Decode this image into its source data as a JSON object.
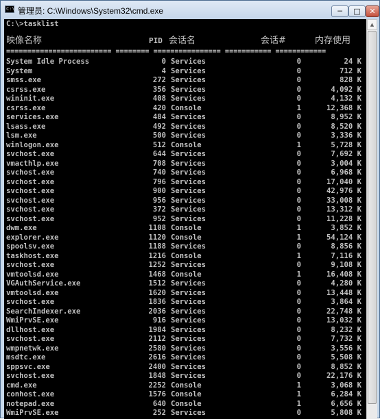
{
  "window": {
    "title": "管理员: C:\\Windows\\System32\\cmd.exe",
    "icon_label": "C:\\",
    "minimize_glyph": "─",
    "maximize_glyph": "□",
    "close_glyph": "✕"
  },
  "console": {
    "prompt_line": "C:\\>tasklist",
    "headers": {
      "image_name": "映像名称",
      "pid": "PID",
      "session_name": "会话名",
      "session_num": "会话#",
      "mem_usage": "内存使用"
    },
    "separator": "========================= ======== ================ =========== ============",
    "processes": [
      {
        "name": "System Idle Process",
        "pid": "0",
        "session": "Services",
        "num": "0",
        "mem": "24 K"
      },
      {
        "name": "System",
        "pid": "4",
        "session": "Services",
        "num": "0",
        "mem": "712 K"
      },
      {
        "name": "smss.exe",
        "pid": "272",
        "session": "Services",
        "num": "0",
        "mem": "828 K"
      },
      {
        "name": "csrss.exe",
        "pid": "356",
        "session": "Services",
        "num": "0",
        "mem": "4,092 K"
      },
      {
        "name": "wininit.exe",
        "pid": "408",
        "session": "Services",
        "num": "0",
        "mem": "4,132 K"
      },
      {
        "name": "csrss.exe",
        "pid": "420",
        "session": "Console",
        "num": "1",
        "mem": "12,368 K"
      },
      {
        "name": "services.exe",
        "pid": "484",
        "session": "Services",
        "num": "0",
        "mem": "8,952 K"
      },
      {
        "name": "lsass.exe",
        "pid": "492",
        "session": "Services",
        "num": "0",
        "mem": "8,520 K"
      },
      {
        "name": "lsm.exe",
        "pid": "500",
        "session": "Services",
        "num": "0",
        "mem": "3,336 K"
      },
      {
        "name": "winlogon.exe",
        "pid": "512",
        "session": "Console",
        "num": "1",
        "mem": "5,728 K"
      },
      {
        "name": "svchost.exe",
        "pid": "644",
        "session": "Services",
        "num": "0",
        "mem": "7,692 K"
      },
      {
        "name": "vmacthlp.exe",
        "pid": "708",
        "session": "Services",
        "num": "0",
        "mem": "3,004 K"
      },
      {
        "name": "svchost.exe",
        "pid": "740",
        "session": "Services",
        "num": "0",
        "mem": "6,968 K"
      },
      {
        "name": "svchost.exe",
        "pid": "796",
        "session": "Services",
        "num": "0",
        "mem": "17,040 K"
      },
      {
        "name": "svchost.exe",
        "pid": "900",
        "session": "Services",
        "num": "0",
        "mem": "42,976 K"
      },
      {
        "name": "svchost.exe",
        "pid": "956",
        "session": "Services",
        "num": "0",
        "mem": "33,008 K"
      },
      {
        "name": "svchost.exe",
        "pid": "372",
        "session": "Services",
        "num": "0",
        "mem": "13,312 K"
      },
      {
        "name": "svchost.exe",
        "pid": "952",
        "session": "Services",
        "num": "0",
        "mem": "11,228 K"
      },
      {
        "name": "dwm.exe",
        "pid": "1108",
        "session": "Console",
        "num": "1",
        "mem": "3,852 K"
      },
      {
        "name": "explorer.exe",
        "pid": "1120",
        "session": "Console",
        "num": "1",
        "mem": "54,124 K"
      },
      {
        "name": "spoolsv.exe",
        "pid": "1188",
        "session": "Services",
        "num": "0",
        "mem": "8,856 K"
      },
      {
        "name": "taskhost.exe",
        "pid": "1216",
        "session": "Console",
        "num": "1",
        "mem": "7,116 K"
      },
      {
        "name": "svchost.exe",
        "pid": "1252",
        "session": "Services",
        "num": "0",
        "mem": "9,108 K"
      },
      {
        "name": "vmtoolsd.exe",
        "pid": "1468",
        "session": "Console",
        "num": "1",
        "mem": "16,408 K"
      },
      {
        "name": "VGAuthService.exe",
        "pid": "1512",
        "session": "Services",
        "num": "0",
        "mem": "4,280 K"
      },
      {
        "name": "vmtoolsd.exe",
        "pid": "1620",
        "session": "Services",
        "num": "0",
        "mem": "13,448 K"
      },
      {
        "name": "svchost.exe",
        "pid": "1836",
        "session": "Services",
        "num": "0",
        "mem": "3,864 K"
      },
      {
        "name": "SearchIndexer.exe",
        "pid": "2036",
        "session": "Services",
        "num": "0",
        "mem": "22,748 K"
      },
      {
        "name": "WmiPrvSE.exe",
        "pid": "916",
        "session": "Services",
        "num": "0",
        "mem": "13,032 K"
      },
      {
        "name": "dllhost.exe",
        "pid": "1984",
        "session": "Services",
        "num": "0",
        "mem": "8,232 K"
      },
      {
        "name": "svchost.exe",
        "pid": "2112",
        "session": "Services",
        "num": "0",
        "mem": "7,732 K"
      },
      {
        "name": "wmpnetwk.exe",
        "pid": "2580",
        "session": "Services",
        "num": "0",
        "mem": "3,556 K"
      },
      {
        "name": "msdtc.exe",
        "pid": "2616",
        "session": "Services",
        "num": "0",
        "mem": "5,508 K"
      },
      {
        "name": "sppsvc.exe",
        "pid": "2400",
        "session": "Services",
        "num": "0",
        "mem": "8,852 K"
      },
      {
        "name": "svchost.exe",
        "pid": "1848",
        "session": "Services",
        "num": "0",
        "mem": "22,176 K"
      },
      {
        "name": "cmd.exe",
        "pid": "2252",
        "session": "Console",
        "num": "1",
        "mem": "3,068 K"
      },
      {
        "name": "conhost.exe",
        "pid": "1576",
        "session": "Console",
        "num": "1",
        "mem": "6,284 K"
      },
      {
        "name": "notepad.exe",
        "pid": "640",
        "session": "Console",
        "num": "1",
        "mem": "6,656 K"
      },
      {
        "name": "WmiPrvSE.exe",
        "pid": "252",
        "session": "Services",
        "num": "0",
        "mem": "5,808 K"
      }
    ]
  },
  "scrollbar": {
    "up_arrow": "▲"
  },
  "colors": {
    "console_bg": "#000000",
    "console_fg": "#c0c0c0",
    "title_bg": "#c5d6ea",
    "close_red": "#c4513e"
  }
}
